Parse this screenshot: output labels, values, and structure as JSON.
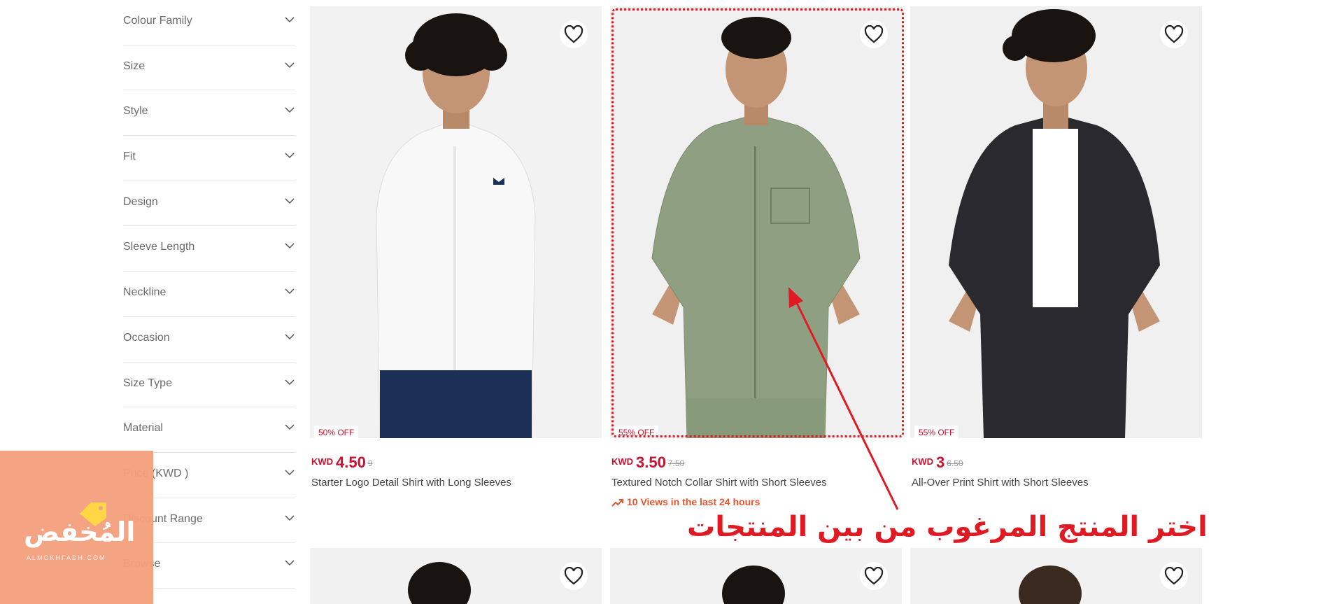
{
  "filters": [
    {
      "label": "Colour Family"
    },
    {
      "label": "Size"
    },
    {
      "label": "Style"
    },
    {
      "label": "Fit"
    },
    {
      "label": "Design"
    },
    {
      "label": "Sleeve Length"
    },
    {
      "label": "Neckline"
    },
    {
      "label": "Occasion"
    },
    {
      "label": "Size Type"
    },
    {
      "label": "Material"
    },
    {
      "label": "Price (KWD )"
    },
    {
      "label": "Discount Range"
    },
    {
      "label": "Browse"
    }
  ],
  "products": [
    {
      "badge": "50% OFF",
      "currency": "KWD",
      "price": "4.50",
      "old_price": "9",
      "name": "Starter Logo Detail Shirt with Long Sleeves",
      "shirt_color": "#f7f7f7"
    },
    {
      "badge": "55% OFF",
      "currency": "KWD",
      "price": "3.50",
      "old_price": "7.50",
      "name": "Textured Notch Collar Shirt with Short Sleeves",
      "views": "10 Views in the last 24 hours",
      "shirt_color": "#8fa082"
    },
    {
      "badge": "55% OFF",
      "currency": "KWD",
      "price": "3",
      "old_price": "6.50",
      "name": "All-Over Print Shirt with Short Sleeves",
      "shirt_color": "#2a2a2e"
    }
  ],
  "annotation": {
    "text": "اختر المنتج المرغوب من بين المنتجات",
    "color": "#e01a22"
  },
  "watermark": {
    "text": "المُخفض",
    "subtext": "ALMOKHFADH.COM"
  },
  "colors": {
    "sale_red": "#c8102e",
    "views_orange": "#e8542c",
    "logo_bg": "#f4a07c"
  }
}
